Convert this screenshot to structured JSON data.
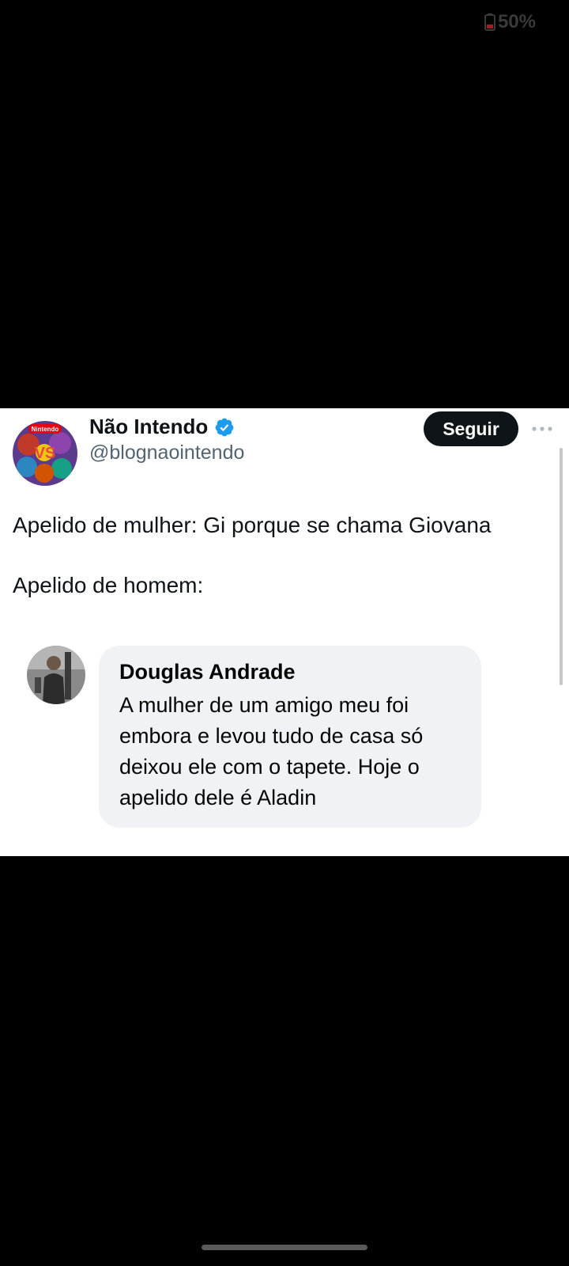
{
  "status_bar": {
    "battery_level": "50%",
    "battery_icon": "battery-low-icon"
  },
  "tweet": {
    "author_name": "Não Intendo",
    "author_handle": "@blognaointendo",
    "verified_icon": "verified-badge-icon",
    "follow_label": "Seguir",
    "more_icon": "more-options-icon",
    "avatar_badge_text": "Nintendo",
    "text_lines": [
      "Apelido de mulher: Gi porque se chama Giovana",
      "Apelido de homem:"
    ]
  },
  "embedded_comment": {
    "author": "Douglas Andrade",
    "text_lines": [
      "A mulher de um amigo meu foi",
      "embora e levou tudo de casa só",
      "deixou ele com o tapete. Hoje o",
      "apelido dele é Aladin"
    ]
  },
  "colors": {
    "background": "#000000",
    "card": "#ffffff",
    "follow_button": "#0f1419",
    "verified": "#1d9bf0",
    "handle": "#536471",
    "comment_bubble": "#f0f2f5"
  }
}
